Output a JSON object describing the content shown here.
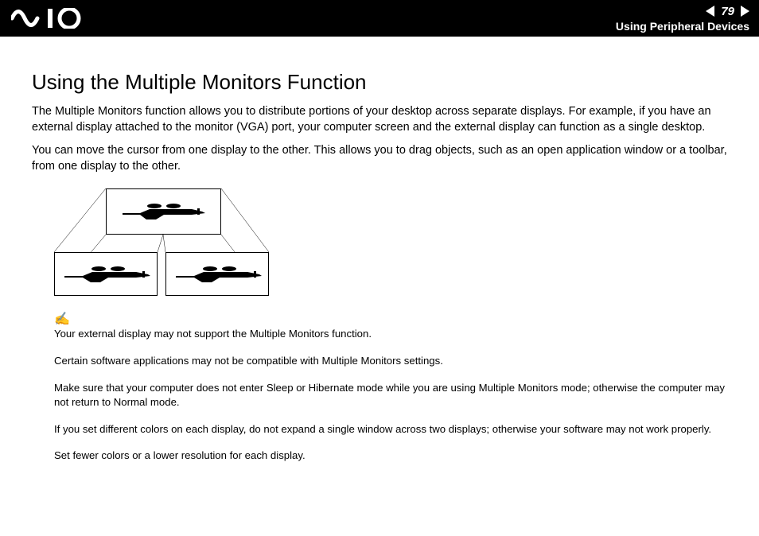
{
  "header": {
    "page_number": "79",
    "section": "Using Peripheral Devices"
  },
  "body": {
    "title": "Using the Multiple Monitors Function",
    "para1": "The Multiple Monitors function allows you to distribute portions of your desktop across separate displays. For example, if you have an external display attached to the monitor (VGA) port, your computer screen and the external display can function as a single desktop.",
    "para2": "You can move the cursor from one display to the other. This allows you to drag objects, such as an open application window or a toolbar, from one display to the other."
  },
  "notes": {
    "n1": "Your external display may not support the Multiple Monitors function.",
    "n2": "Certain software applications may not be compatible with Multiple Monitors settings.",
    "n3": "Make sure that your computer does not enter Sleep or Hibernate mode while you are using Multiple Monitors mode; otherwise the computer may not return to Normal mode.",
    "n4": "If you set different colors on each display, do not expand a single window across two displays; otherwise your software may not work properly.",
    "n5": "Set fewer colors or a lower resolution for each display."
  }
}
